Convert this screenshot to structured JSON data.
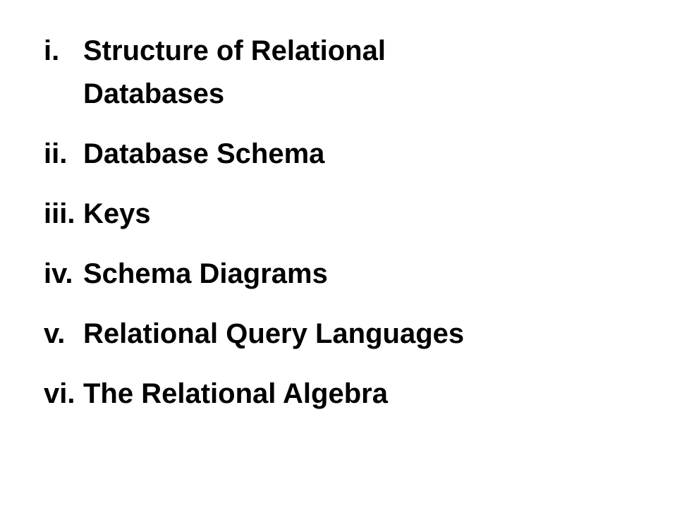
{
  "topics": [
    {
      "numeral": "i.",
      "text": "Structure of Relational Databases"
    },
    {
      "numeral": "ii.",
      "text": "Database Schema"
    },
    {
      "numeral": "iii.",
      "text": "Keys"
    },
    {
      "numeral": "iv.",
      "text": "Schema Diagrams"
    },
    {
      "numeral": "v.",
      "text": "Relational Query Languages"
    },
    {
      "numeral": "vi.",
      "text": "The Relational Algebra"
    }
  ]
}
